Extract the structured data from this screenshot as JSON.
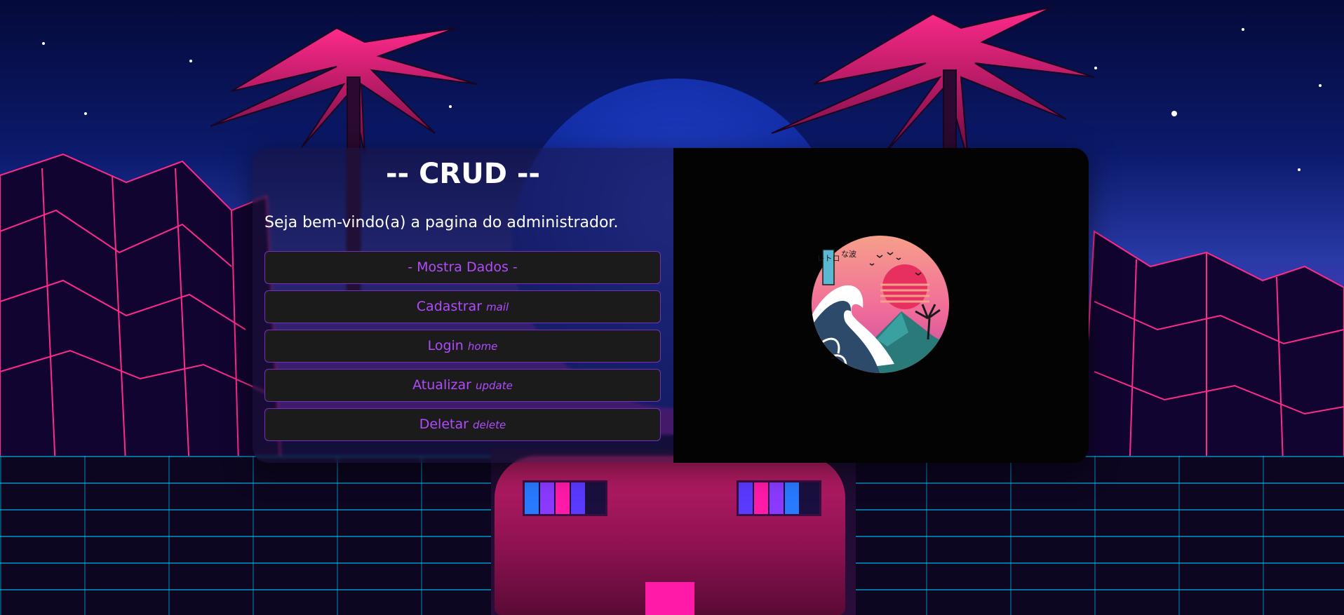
{
  "page": {
    "title": "-- CRUD --",
    "welcome": "Seja bem-vindo(a) a pagina do administrador."
  },
  "menu": {
    "mostra_dados": "- Mostra Dados -",
    "cadastrar": {
      "label": "Cadastrar",
      "tag": "mail"
    },
    "login": {
      "label": "Login",
      "tag": "home"
    },
    "atualizar": {
      "label": "Atualizar",
      "tag": "update"
    },
    "deletar": {
      "label": "Deletar",
      "tag": "delete"
    }
  },
  "logo": {
    "icon": "great-wave-retro-logo",
    "text_vertical": "レトロ",
    "text_side": "な波"
  },
  "colors": {
    "accent": "#b24bff",
    "button_bg": "#1b1b1b",
    "panel_right_bg": "#030303"
  }
}
